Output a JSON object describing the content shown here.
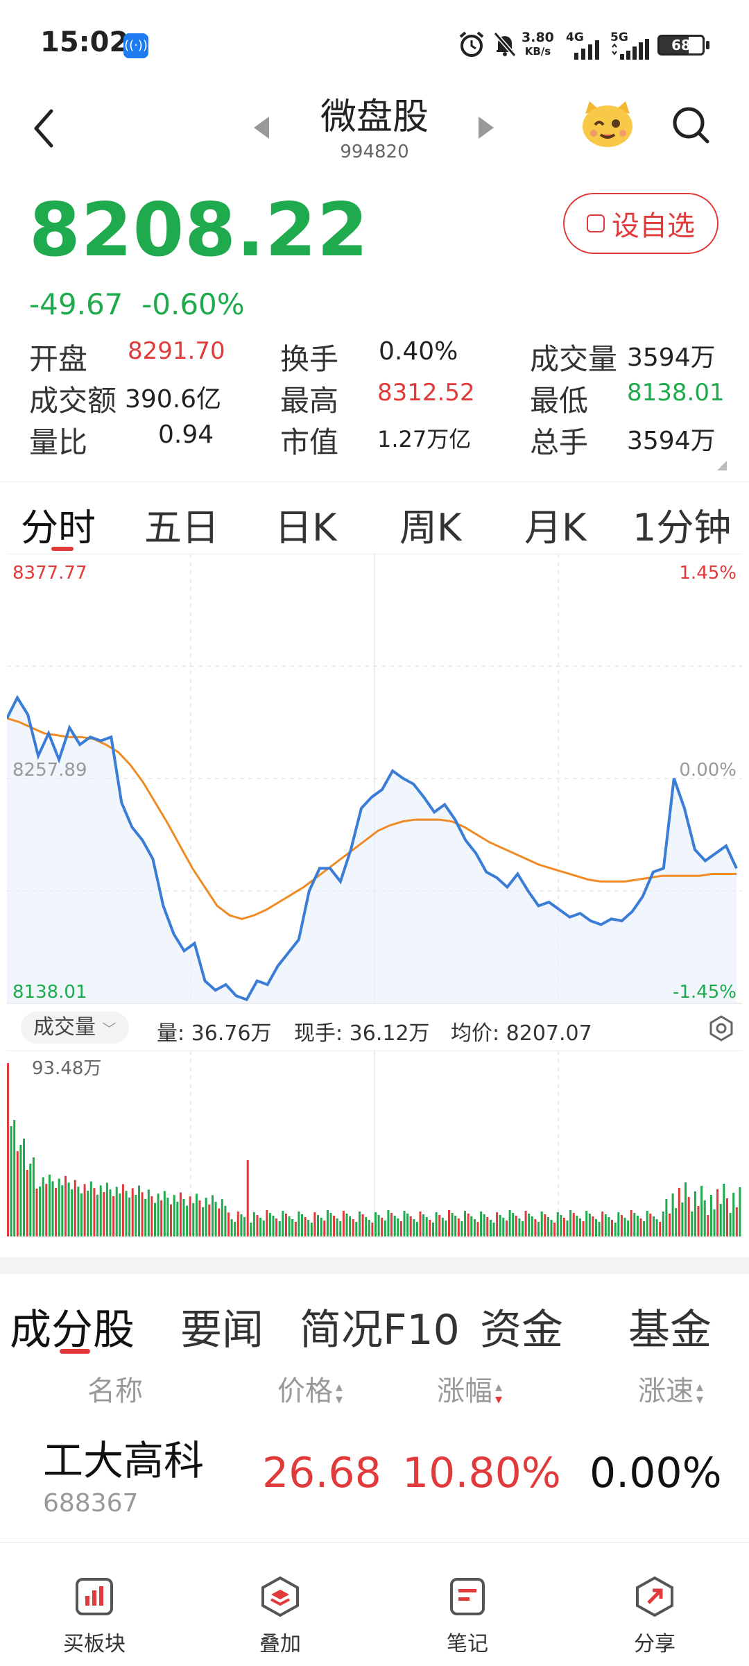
{
  "status_bar": {
    "time": "15:02",
    "network_speed_value": "3.80",
    "network_speed_unit": "KB/s",
    "net_4g": "4G",
    "net_5g": "5G",
    "battery": "68"
  },
  "header": {
    "title": "微盘股",
    "code": "994820"
  },
  "quote": {
    "price": "8208.22",
    "change": "-49.67",
    "change_pct": "-0.60%",
    "fav_label": "设自选",
    "stats": [
      {
        "label": "开盘",
        "value": "8291.70",
        "color": "red"
      },
      {
        "label": "换手",
        "value": "0.40%",
        "color": "dark"
      },
      {
        "label": "成交量",
        "value": "3594万",
        "color": "dark"
      },
      {
        "label": "成交额",
        "value": "390.6亿",
        "color": "dark"
      },
      {
        "label": "最高",
        "value": "8312.52",
        "color": "red"
      },
      {
        "label": "最低",
        "value": "8138.01",
        "color": "green"
      },
      {
        "label": "量比",
        "value": "0.94",
        "color": "dark"
      },
      {
        "label": "市值",
        "value": "1.27万亿",
        "color": "dark"
      },
      {
        "label": "总手",
        "value": "3594万",
        "color": "dark"
      }
    ]
  },
  "chart_tabs": [
    "分时",
    "五日",
    "日K",
    "周K",
    "月K",
    "1分钟"
  ],
  "chart_axis": {
    "top_price": "8377.77",
    "mid_price": "8257.89",
    "bottom_price": "8138.01",
    "top_pct": "1.45%",
    "mid_pct": "0.00%",
    "bottom_pct": "-1.45%"
  },
  "volume_bar": {
    "selector": "成交量",
    "vol": "量: 36.76万",
    "now": "现手: 36.12万",
    "avg": "均价: 8207.07",
    "max_label": "93.48万"
  },
  "chart_data": {
    "type": "line",
    "ylim": [
      8138.01,
      8377.77
    ],
    "series": [
      {
        "values": [
          8290,
          8301,
          8292,
          8270,
          8282,
          8268,
          8285,
          8276,
          8280,
          8278,
          8280,
          8245,
          8232,
          8225,
          8215,
          8190,
          8175,
          8166,
          8170,
          8150,
          8145,
          8148,
          8142,
          8140,
          8150,
          8148,
          8158,
          8165,
          8172,
          8198,
          8210,
          8210,
          8203,
          8220,
          8242,
          8248,
          8252,
          8262,
          8258,
          8255,
          8248,
          8240,
          8244,
          8236,
          8225,
          8218,
          8208,
          8205,
          8200,
          8207,
          8198,
          8190,
          8192,
          8188,
          8184,
          8186,
          8182,
          8180,
          8183,
          8182,
          8187,
          8195,
          8208,
          8210,
          8258,
          8242,
          8220,
          8214,
          8218,
          8222,
          8210
        ]
      },
      {
        "values": [
          8290,
          8288,
          8285,
          8282,
          8281,
          8280,
          8280,
          8279,
          8276,
          8272,
          8265,
          8256,
          8245,
          8234,
          8222,
          8210,
          8200,
          8190,
          8185,
          8183,
          8185,
          8188,
          8192,
          8196,
          8200,
          8205,
          8210,
          8215,
          8220,
          8225,
          8230,
          8233,
          8235,
          8236,
          8236,
          8236,
          8235,
          8232,
          8228,
          8224,
          8221,
          8218,
          8215,
          8212,
          8210,
          8208,
          8206,
          8204,
          8203,
          8203,
          8203,
          8204,
          8205,
          8206,
          8206,
          8206,
          8206,
          8207,
          8207,
          8207
        ]
      }
    ]
  },
  "bottom_tabs": [
    "成分股",
    "要闻",
    "简况F10",
    "资金",
    "基金"
  ],
  "table": {
    "headers": [
      "名称",
      "价格",
      "涨幅",
      "涨速"
    ],
    "rows": [
      {
        "name": "工大高科",
        "code": "688367",
        "price": "26.68",
        "change": "10.80%",
        "speed": "0.00%"
      }
    ]
  },
  "bottom_nav": [
    {
      "label": "买板块",
      "icon": "chart-bar-icon"
    },
    {
      "label": "叠加",
      "icon": "layers-icon"
    },
    {
      "label": "笔记",
      "icon": "note-icon"
    },
    {
      "label": "分享",
      "icon": "share-icon"
    }
  ],
  "colors": {
    "up": "#e03a3a",
    "down": "#1faa4d",
    "price_line": "#3a7dd6",
    "avg_line": "#f08a24"
  }
}
